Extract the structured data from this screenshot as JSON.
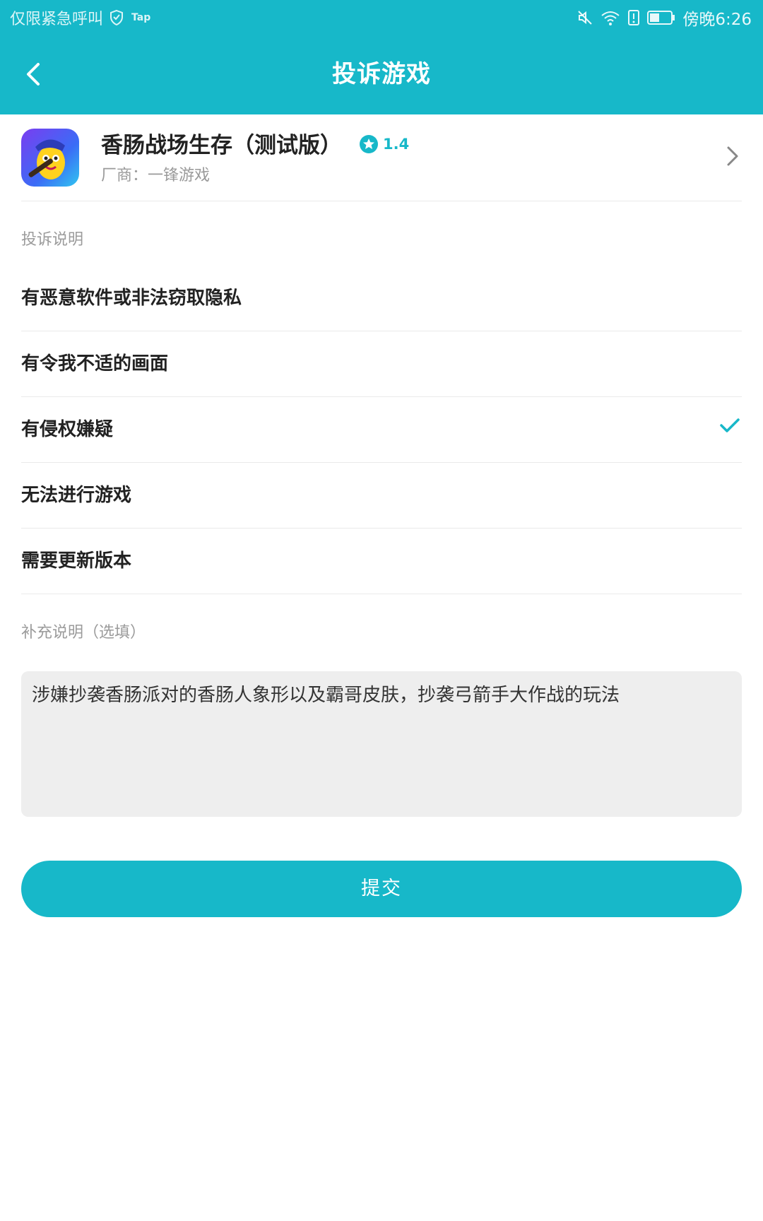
{
  "status_bar": {
    "emergency_text": "仅限紧急呼叫",
    "tap_label": "Tap",
    "time": "傍晚6:26"
  },
  "header": {
    "title": "投诉游戏"
  },
  "game": {
    "name": "香肠战场生存（测试版）",
    "rating": "1.4",
    "vendor": "厂商：一锋游戏"
  },
  "complaint": {
    "section_label": "投诉说明",
    "options": [
      {
        "label": "有恶意软件或非法窃取隐私",
        "selected": false
      },
      {
        "label": "有令我不适的画面",
        "selected": false
      },
      {
        "label": "有侵权嫌疑",
        "selected": true
      },
      {
        "label": "无法进行游戏",
        "selected": false
      },
      {
        "label": "需要更新版本",
        "selected": false
      }
    ]
  },
  "supplement": {
    "section_label": "补充说明（选填）",
    "text": "涉嫌抄袭香肠派对的香肠人象形以及霸哥皮肤，抄袭弓箭手大作战的玩法"
  },
  "submit_label": "提交",
  "colors": {
    "accent": "#17b8c9",
    "field_bg": "#eeeeee"
  }
}
